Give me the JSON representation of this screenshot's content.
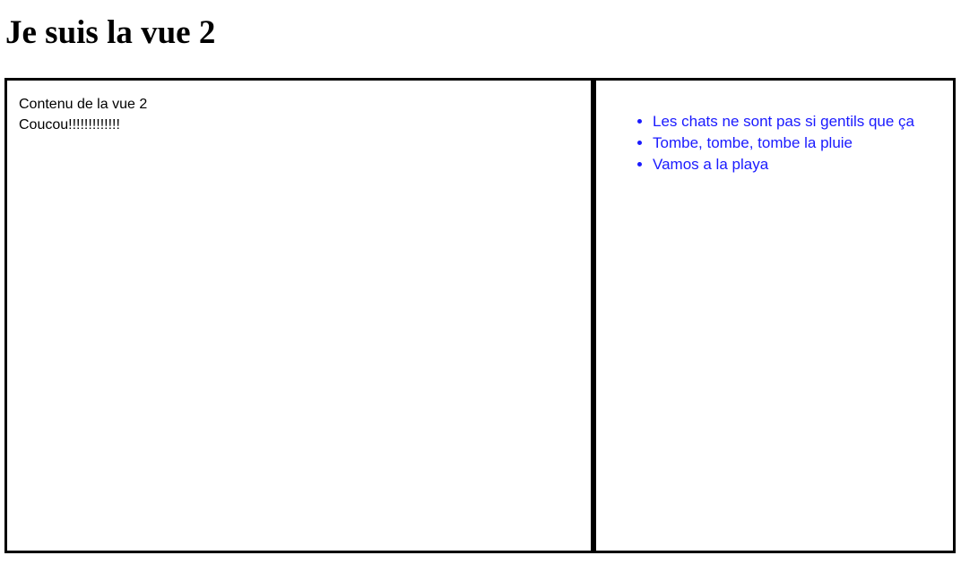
{
  "header": {
    "title": "Je suis la vue 2"
  },
  "main": {
    "lines": [
      "Contenu de la vue 2",
      "Coucou!!!!!!!!!!!!!"
    ]
  },
  "aside": {
    "links": [
      "Les chats ne sont pas si gentils que ça",
      "Tombe, tombe, tombe la pluie",
      "Vamos a la playa"
    ],
    "link_color": "#1a1aff"
  }
}
